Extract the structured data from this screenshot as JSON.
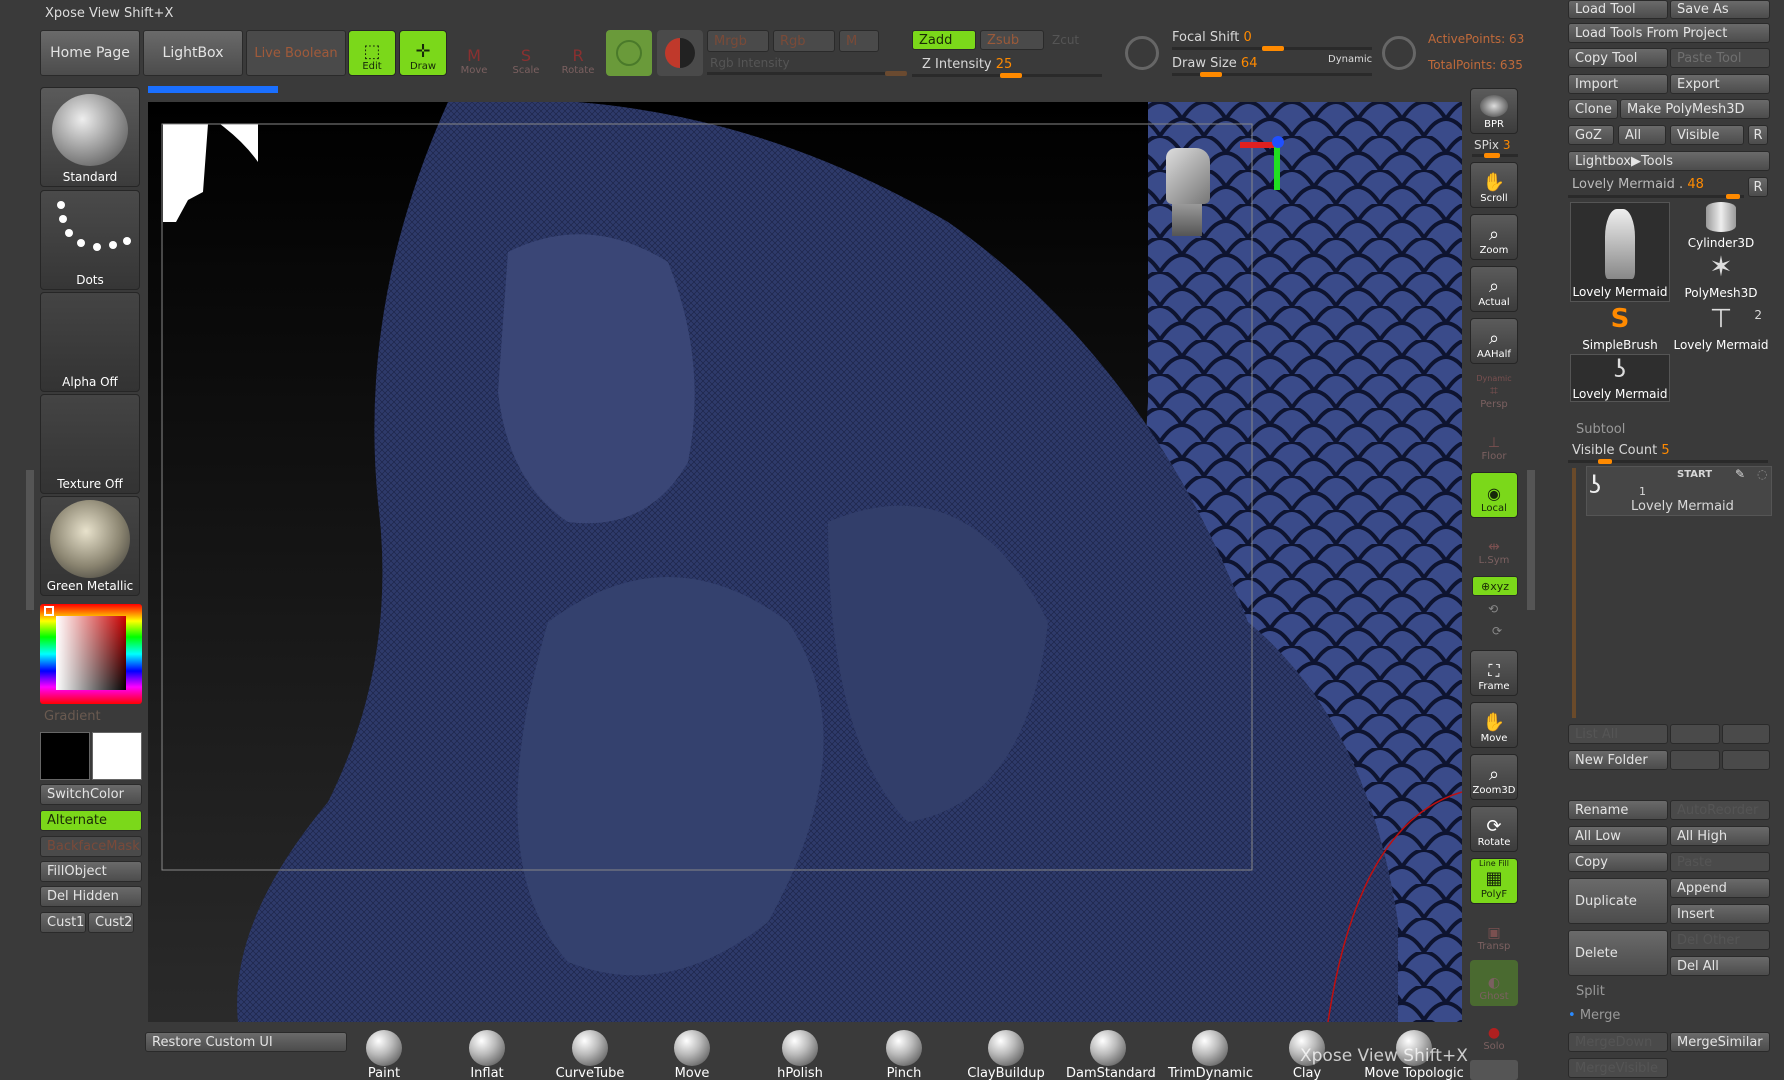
{
  "xpose_title": "Xpose View Shift+X",
  "top": {
    "home": "Home Page",
    "lightbox": "LightBox",
    "live_boolean": "Live Boolean",
    "edit": "Edit",
    "draw": "Draw",
    "move": "Move",
    "scale": "Scale",
    "rotate": "Rotate",
    "mrgb": "Mrgb",
    "rgb": "Rgb",
    "m": "M",
    "rgb_intensity": "Rgb Intensity",
    "zadd": "Zadd",
    "zsub": "Zsub",
    "zcut": "Zcut",
    "z_intensity_label": "Z Intensity",
    "z_intensity_value": "25",
    "focal_shift_label": "Focal Shift",
    "focal_shift_value": "0",
    "draw_size_label": "Draw Size",
    "draw_size_value": "64",
    "dynamic": "Dynamic",
    "active_points": "ActivePoints: 63",
    "total_points": "TotalPoints: 635"
  },
  "left": {
    "brush": "Standard",
    "stroke": "Dots",
    "alpha": "Alpha Off",
    "texture": "Texture Off",
    "material": "Green Metallic",
    "gradient": "Gradient",
    "switch_color": "SwitchColor",
    "alternate": "Alternate",
    "backface": "BackfaceMask",
    "fill_object": "FillObject",
    "del_hidden": "Del Hidden",
    "cust1": "Cust1",
    "cust2": "Cust2",
    "restore_ui": "Restore Custom UI"
  },
  "right_bar": {
    "bpr": "BPR",
    "spix_label": "SPix",
    "spix_value": "3",
    "scroll": "Scroll",
    "zoom": "Zoom",
    "actual": "Actual",
    "aahalf": "AAHalf",
    "persp": "Persp",
    "dynamic": "Dynamic",
    "floor": "Floor",
    "local": "Local",
    "lsym": "L.Sym",
    "xyz": "⊕xyz",
    "frame": "Frame",
    "move": "Move",
    "zoom3d": "Zoom3D",
    "rotate": "Rotate",
    "linefill": "Line Fill",
    "polyf": "PolyF",
    "transp": "Transp",
    "ghost": "Ghost",
    "solo": "Solo"
  },
  "tool": {
    "load_tool": "Load Tool",
    "save_as": "Save As",
    "load_from_project": "Load Tools From Project",
    "copy_tool": "Copy Tool",
    "paste_tool": "Paste Tool",
    "import": "Import",
    "export": "Export",
    "clone": "Clone",
    "make_polymesh": "Make PolyMesh3D",
    "goz": "GoZ",
    "all": "All",
    "visible": "Visible",
    "r": "R",
    "lightbox_tools": "Lightbox▶Tools",
    "current_label": "Lovely Mermaid .",
    "current_value": "48",
    "thumbs": [
      {
        "label": "Lovely Mermaid"
      },
      {
        "label": "Cylinder3D"
      },
      {
        "label": "PolyMesh3D"
      },
      {
        "label": "SimpleBrush"
      },
      {
        "label": "Lovely Mermaid",
        "badge": "2"
      },
      {
        "label": "Lovely Mermaid"
      }
    ]
  },
  "subtool": {
    "header": "Subtool",
    "visible_count_label": "Visible Count",
    "visible_count_value": "5",
    "item_start": "START",
    "item_num": "1",
    "item_name": "Lovely Mermaid",
    "list_all": "List All",
    "new_folder": "New Folder",
    "rename": "Rename",
    "auto_reorder": "AutoReorder",
    "all_low": "All Low",
    "all_high": "All High",
    "copy": "Copy",
    "paste": "Paste",
    "duplicate": "Duplicate",
    "append": "Append",
    "insert": "Insert",
    "delete": "Delete",
    "del_other": "Del Other",
    "del_all": "Del All",
    "split": "Split",
    "merge": "Merge",
    "merge_down": "MergeDown",
    "merge_similar": "MergeSimilar",
    "merge_visible": "MergeVisible"
  },
  "shelf": {
    "brushes": [
      "Paint",
      "Inflat",
      "CurveTube",
      "Move",
      "hPolish",
      "Pinch",
      "ClayBuildup",
      "DamStandard",
      "TrimDynamic",
      "Clay",
      "Move Topologic"
    ],
    "xpose_overlay": "Xpose View  Shift+X"
  }
}
